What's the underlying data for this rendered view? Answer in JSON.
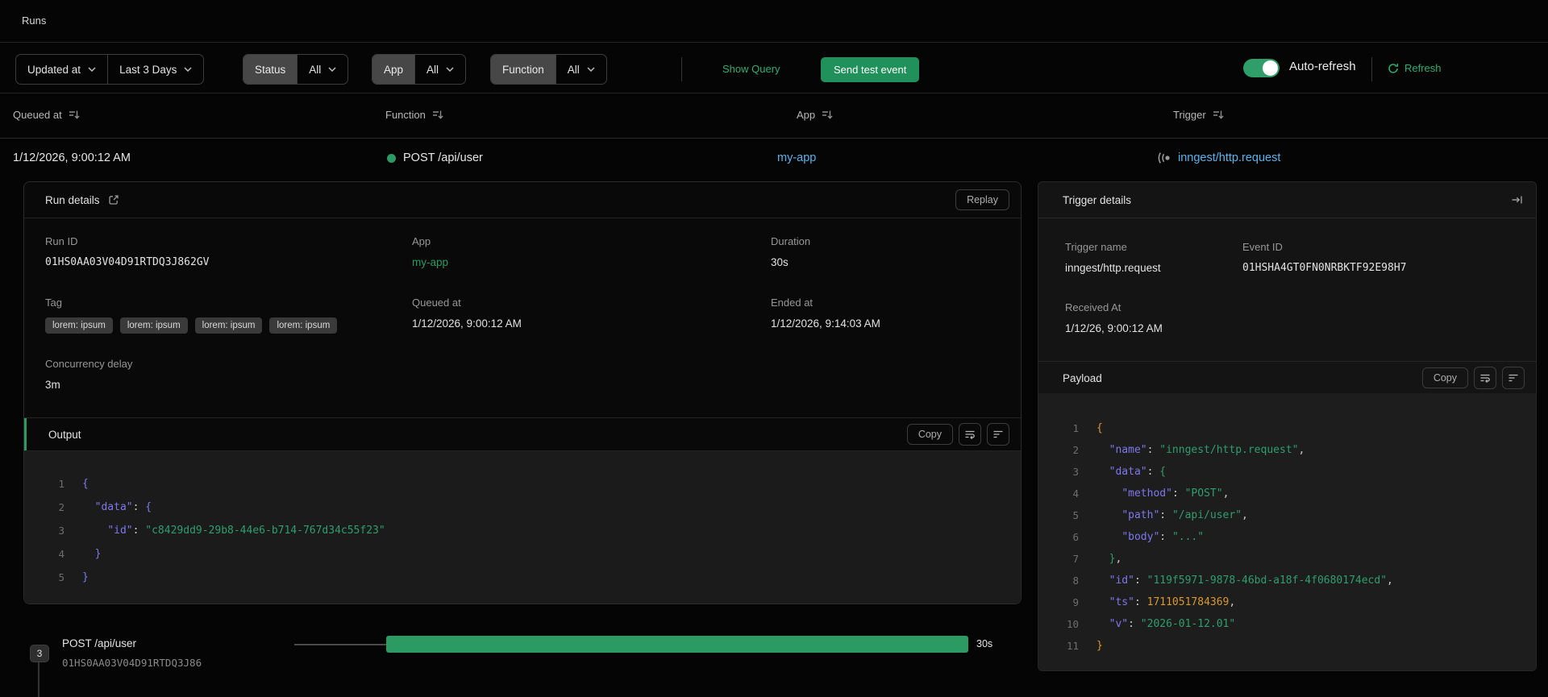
{
  "page": {
    "title": "Runs"
  },
  "filters": {
    "sort_field": "Updated at",
    "time_range": "Last 3 Days",
    "status": {
      "label": "Status",
      "value": "All"
    },
    "app": {
      "label": "App",
      "value": "All"
    },
    "function": {
      "label": "Function",
      "value": "All"
    },
    "show_query": "Show Query",
    "send_test_event": "Send test event",
    "auto_refresh_label": "Auto-refresh",
    "refresh_label": "Refresh"
  },
  "table": {
    "columns": [
      "Queued at",
      "Function",
      "App",
      "Trigger"
    ],
    "row": {
      "queued_at": "1/12/2026, 9:00:12 AM",
      "function": "POST /api/user",
      "status_color": "#2c9b63",
      "app": "my-app",
      "trigger": "inngest/http.request"
    }
  },
  "run_details": {
    "title": "Run details",
    "replay_label": "Replay",
    "fields": {
      "run_id": {
        "label": "Run ID",
        "value": "01HS0AA03V04D91RTDQ3J862GV"
      },
      "app": {
        "label": "App",
        "value": "my-app"
      },
      "duration": {
        "label": "Duration",
        "value": "30s"
      },
      "tag_label": "Tag",
      "queued_at": {
        "label": "Queued at",
        "value": "1/12/2026, 9:00:12 AM"
      },
      "ended_at": {
        "label": "Ended at",
        "value": "1/12/2026, 9:14:03 AM"
      },
      "concurrency_delay": {
        "label": "Concurrency delay",
        "value": "3m"
      }
    },
    "tags": [
      "lorem: ipsum",
      "lorem: ipsum",
      "lorem: ipsum",
      "lorem: ipsum"
    ],
    "output": {
      "title": "Output",
      "copy_label": "Copy",
      "lines": [
        [
          [
            "bp",
            "{"
          ]
        ],
        [
          [
            "p",
            "  "
          ],
          [
            "k",
            "\"data\""
          ],
          [
            "p",
            ": "
          ],
          [
            "bp",
            "{"
          ]
        ],
        [
          [
            "p",
            "    "
          ],
          [
            "k",
            "\"id\""
          ],
          [
            "p",
            ": "
          ],
          [
            "s",
            "\"c8429dd9-29b8-44e6-b714-767d34c55f23\""
          ]
        ],
        [
          [
            "p",
            "  "
          ],
          [
            "bp",
            "}"
          ]
        ],
        [
          [
            "bp",
            "}"
          ]
        ]
      ]
    }
  },
  "trigger_details": {
    "title": "Trigger details",
    "fields": {
      "trigger_name": {
        "label": "Trigger name",
        "value": "inngest/http.request"
      },
      "event_id": {
        "label": "Event ID",
        "value": "01HSHA4GT0FN0NRBKTF92E98H7"
      },
      "received_at": {
        "label": "Received At",
        "value": "1/12/26, 9:00:12 AM"
      }
    },
    "payload": {
      "title": "Payload",
      "copy_label": "Copy",
      "lines": [
        [
          [
            "bg1",
            "{"
          ]
        ],
        [
          [
            "p",
            "  "
          ],
          [
            "k",
            "\"name\""
          ],
          [
            "p",
            ": "
          ],
          [
            "s",
            "\"inngest/http.request\""
          ],
          [
            "p",
            ","
          ]
        ],
        [
          [
            "p",
            "  "
          ],
          [
            "k",
            "\"data\""
          ],
          [
            "p",
            ": "
          ],
          [
            "bg2",
            "{"
          ]
        ],
        [
          [
            "p",
            "    "
          ],
          [
            "k",
            "\"method\""
          ],
          [
            "p",
            ": "
          ],
          [
            "s",
            "\"POST\""
          ],
          [
            "p",
            ","
          ]
        ],
        [
          [
            "p",
            "    "
          ],
          [
            "k",
            "\"path\""
          ],
          [
            "p",
            ": "
          ],
          [
            "s",
            "\"/api/user\""
          ],
          [
            "p",
            ","
          ]
        ],
        [
          [
            "p",
            "    "
          ],
          [
            "k",
            "\"body\""
          ],
          [
            "p",
            ": "
          ],
          [
            "s",
            "\"...\""
          ]
        ],
        [
          [
            "p",
            "  "
          ],
          [
            "bg2",
            "}"
          ],
          [
            "p",
            ","
          ]
        ],
        [
          [
            "p",
            "  "
          ],
          [
            "k",
            "\"id\""
          ],
          [
            "p",
            ": "
          ],
          [
            "s",
            "\"119f5971-9878-46bd-a18f-4f0680174ecd\""
          ],
          [
            "p",
            ","
          ]
        ],
        [
          [
            "p",
            "  "
          ],
          [
            "k",
            "\"ts\""
          ],
          [
            "p",
            ": "
          ],
          [
            "n",
            "1711051784369"
          ],
          [
            "p",
            ","
          ]
        ],
        [
          [
            "p",
            "  "
          ],
          [
            "k",
            "\"v\""
          ],
          [
            "p",
            ": "
          ],
          [
            "s",
            "\"2026-01-12.01\""
          ]
        ],
        [
          [
            "bg1",
            "}"
          ]
        ]
      ]
    }
  },
  "timeline": {
    "step_count": "3",
    "function": "POST /api/user",
    "run_id": "01HS0AA03V04D91RTDQ3J86",
    "duration": "30s"
  },
  "colors": {
    "accent_green": "#2c9b63",
    "link_blue": "#5cb2ea",
    "button_green": "#20915b",
    "code_key": "#7d78ec",
    "code_string": "#2f9e6c",
    "code_number": "#d9992b"
  }
}
